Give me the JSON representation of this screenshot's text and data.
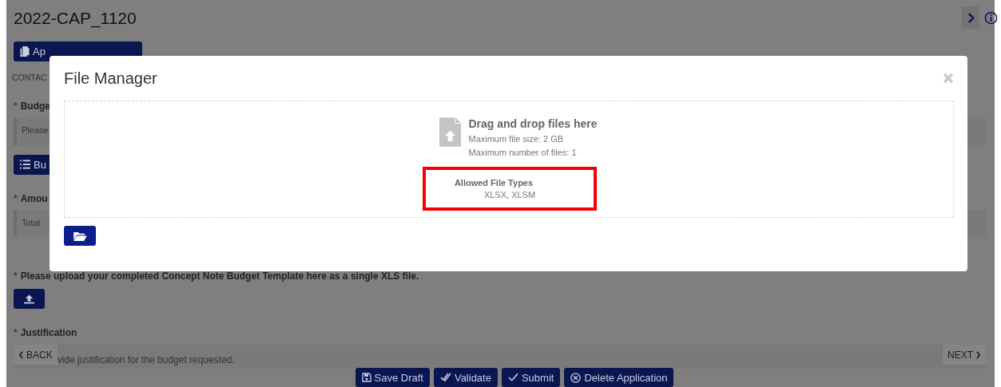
{
  "page": {
    "title": "2022-CAP_1120",
    "summary_button": "Ap",
    "section_label": "CONTAC",
    "fields": [
      {
        "kind": "text",
        "label": "Budge",
        "required": true,
        "value": "Please",
        "button": "Bu"
      },
      {
        "kind": "text",
        "label": "Amou",
        "required": true,
        "value": "Total"
      },
      {
        "kind": "upload",
        "label": "Please upload your completed Concept Note Budget Template here as a single XLS file.",
        "required": true
      },
      {
        "kind": "text",
        "label": "Justification",
        "required": true,
        "value": "vide justification for the budget requested."
      }
    ],
    "required_mark": "*",
    "back": "BACK",
    "next": "NEXT",
    "actions": [
      {
        "kind": "save",
        "label": "Save Draft"
      },
      {
        "kind": "validate",
        "label": "Validate"
      },
      {
        "kind": "submit",
        "label": "Submit"
      },
      {
        "kind": "delete",
        "label": "Delete Application"
      }
    ]
  },
  "dialog": {
    "title": "File Manager",
    "dropzone": {
      "heading": "Drag and drop files here",
      "lines": [
        "Maximum file size: 2 GB",
        "Maximum number of files: 1"
      ],
      "allowed_title": "Allowed File Types",
      "allowed_types": "XLSX,  XLSM",
      "highlighted": true
    }
  }
}
